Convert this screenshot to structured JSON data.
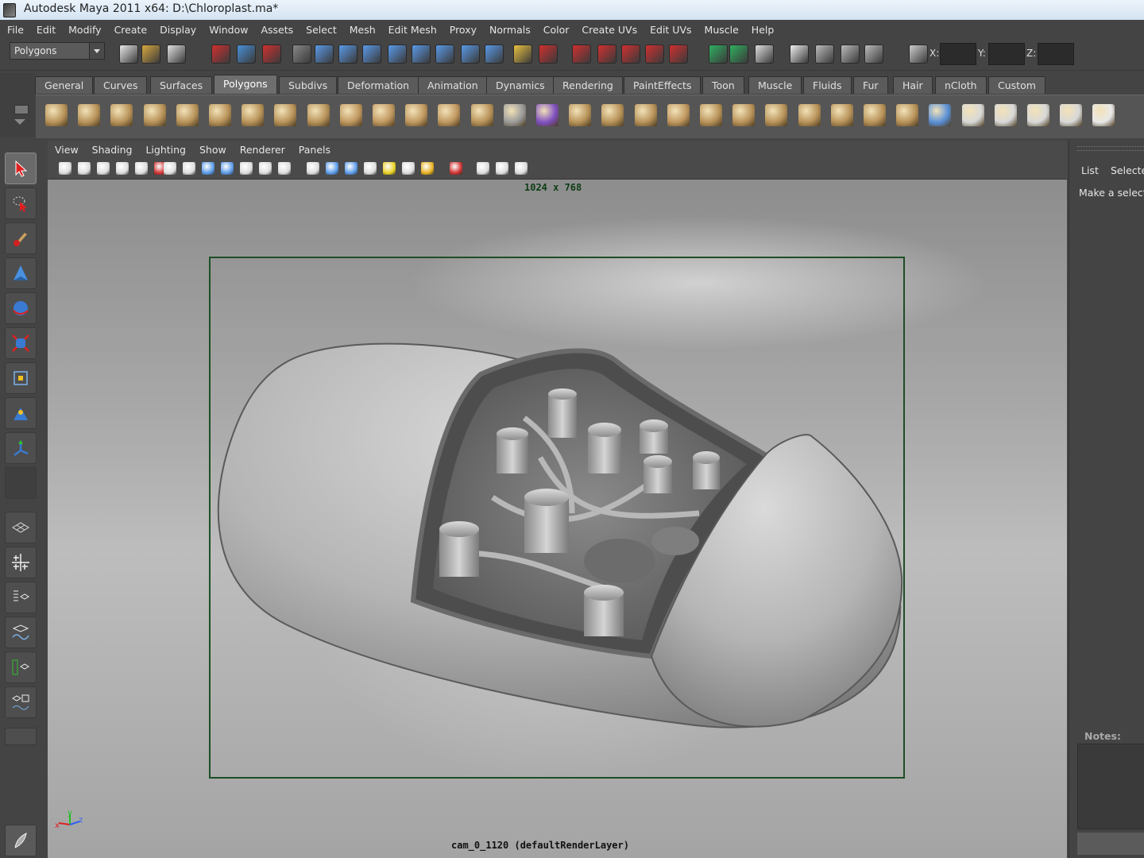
{
  "window": {
    "title": "Autodesk Maya 2011 x64: D:\\Chloroplast.ma*"
  },
  "menubar": {
    "items": [
      "File",
      "Edit",
      "Modify",
      "Create",
      "Display",
      "Window",
      "Assets",
      "Select",
      "Mesh",
      "Edit Mesh",
      "Proxy",
      "Normals",
      "Color",
      "Create UVs",
      "Edit UVs",
      "Muscle",
      "Help"
    ]
  },
  "statusline": {
    "mode_value": "Polygons",
    "x_label": "X:",
    "y_label": "Y:",
    "z_label": "Z:",
    "x_value": "",
    "y_value": "",
    "z_value": ""
  },
  "shelf": {
    "tabs": [
      "General",
      "Curves",
      "Surfaces",
      "Polygons",
      "Subdivs",
      "Deformation",
      "Animation",
      "Dynamics",
      "Rendering",
      "PaintEffects",
      "Toon",
      "Muscle",
      "Fluids",
      "Fur",
      "Hair",
      "nCloth",
      "Custom"
    ],
    "active_tab": "Polygons",
    "icons": [
      "sphere",
      "cube",
      "cylinder",
      "cone",
      "plane",
      "torus",
      "pyramid",
      "pipe",
      "soccer-ball",
      "combine",
      "separate",
      "extract",
      "smooth",
      "boolean",
      "average-vertices",
      "mirror",
      "append",
      "split",
      "insert-edge-loop",
      "offset-edge-loop",
      "bevel",
      "extrude",
      "bridge",
      "merge",
      "collapse",
      "fill-hole",
      "triangulate",
      "quadrangulate",
      "planar-map",
      "cylindrical-map",
      "spherical-map",
      "auto-map",
      "uv-editor"
    ]
  },
  "panel": {
    "menus": [
      "View",
      "Shading",
      "Lighting",
      "Show",
      "Renderer",
      "Panels"
    ],
    "resolution": "1024 x 768",
    "camera_label": "cam_0_1120 (defaultRenderLayer)"
  },
  "axis_gizmo": {
    "x": "x",
    "y": "y",
    "z": "z"
  },
  "rightpanel": {
    "tab_list": "List",
    "tab_selected": "Selecte",
    "message": "Make a selecti",
    "notes_label": "Notes:"
  },
  "colors": {
    "viewport_bg": "#a9a9a9",
    "resolution_gate": "#1d4e25",
    "ui_bg": "#444444"
  }
}
